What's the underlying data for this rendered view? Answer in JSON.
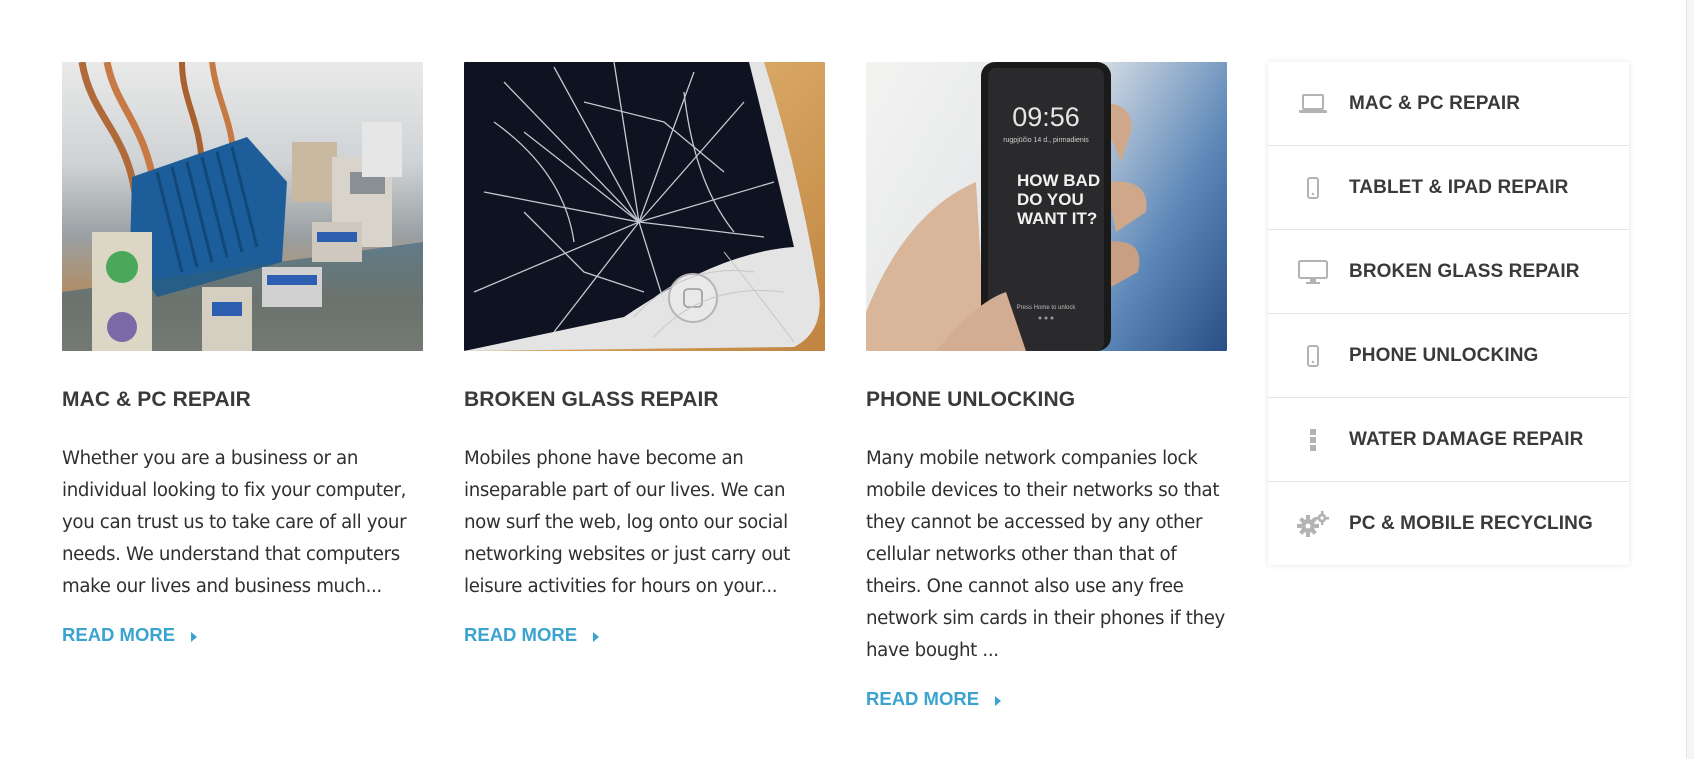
{
  "cards": [
    {
      "title": "MAC & PC REPAIR",
      "text": "Whether you are a business or an individual looking to fix your computer, you can trust us to take care of all your needs. We understand that computers make our lives and business much...",
      "read_more": "READ MORE"
    },
    {
      "title": "BROKEN GLASS REPAIR",
      "text": "Mobiles phone have become an inseparable part of our lives. We can now surf the web, log onto our social networking websites or just carry out leisure activities for hours on your...",
      "read_more": "READ MORE"
    },
    {
      "title": "PHONE UNLOCKING",
      "text": "Many mobile network companies lock mobile devices to their networks so that they cannot be accessed by any other cellular networks other than that of theirs. One cannot also use any free network sim cards in their phones if they have bought ...",
      "read_more": "READ MORE",
      "phone_screen": {
        "time": "09:56",
        "date": "rugpjūčio 14 d., pirmadienis",
        "line1": "HOW BAD",
        "line2": "DO YOU",
        "line3": "WANT IT?",
        "hint": "Press Home to unlock"
      }
    }
  ],
  "services": [
    {
      "label": "MAC & PC REPAIR",
      "icon": "laptop-icon"
    },
    {
      "label": "TABLET & IPAD REPAIR",
      "icon": "mobile-icon"
    },
    {
      "label": "BROKEN GLASS REPAIR",
      "icon": "desktop-icon"
    },
    {
      "label": "PHONE UNLOCKING",
      "icon": "mobile-icon"
    },
    {
      "label": "WATER DAMAGE REPAIR",
      "icon": "ellipsis-vertical-icon"
    },
    {
      "label": "PC & MOBILE RECYCLING",
      "icon": "gears-icon"
    }
  ],
  "colors": {
    "accent": "#3aa3cf",
    "heading": "#3a3a3a",
    "body_text": "#2f2f2f",
    "icon_gray": "#b3b3b3"
  }
}
